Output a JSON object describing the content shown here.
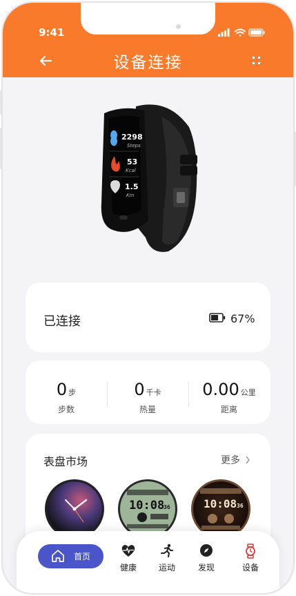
{
  "status_bar": {
    "time": "9:41"
  },
  "header": {
    "title": "设备连接",
    "back_icon": "back-arrow-icon",
    "menu_icon": "grid-dots-icon",
    "color": "#f97a2a"
  },
  "device_preview": {
    "screen_rows": [
      {
        "icon": "footsteps-icon",
        "value": "2298",
        "unit": "Steps"
      },
      {
        "icon": "flame-icon",
        "value": "53",
        "unit": "Kcal"
      },
      {
        "icon": "location-icon",
        "value": "1.5",
        "unit": "Km"
      }
    ]
  },
  "connection": {
    "status": "已连接",
    "battery": "67%",
    "battery_level": 0.67
  },
  "stats": [
    {
      "value": "0",
      "unit": "步",
      "label": "步数"
    },
    {
      "value": "0",
      "unit": "千卡",
      "label": "热量"
    },
    {
      "value": "0.00",
      "unit": "公里",
      "label": "距离"
    }
  ],
  "market": {
    "title": "表盘市场",
    "more": "更多",
    "faces": [
      {
        "name": "analog-face",
        "time": ""
      },
      {
        "name": "digital-face-green",
        "time": "10:08",
        "seconds": "36"
      },
      {
        "name": "digital-face-dark",
        "time": "10:08",
        "seconds": "36"
      }
    ]
  },
  "tabbar": {
    "items": [
      {
        "label": "首页",
        "icon": "home-icon",
        "active": true
      },
      {
        "label": "健康",
        "icon": "heart-pulse-icon"
      },
      {
        "label": "运动",
        "icon": "running-icon"
      },
      {
        "label": "发现",
        "icon": "compass-icon"
      },
      {
        "label": "设备",
        "icon": "watch-icon"
      }
    ],
    "active_color": "#4a55c9"
  }
}
